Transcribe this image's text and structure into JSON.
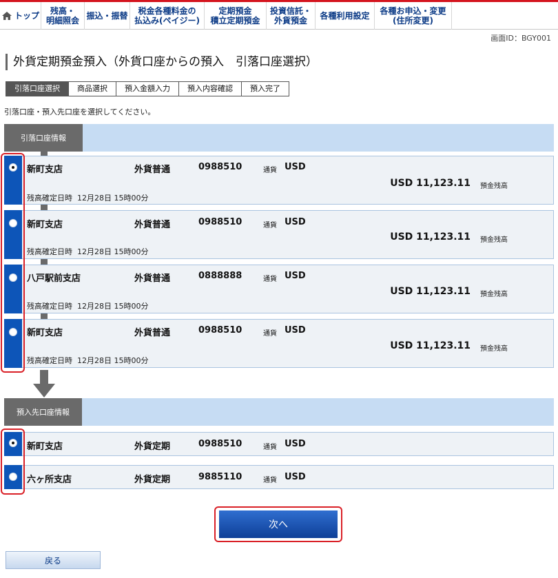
{
  "nav": {
    "items": [
      {
        "label": "トップ",
        "icon": "home-icon"
      },
      {
        "label": "残高・\n明細照会"
      },
      {
        "label": "振込・振替"
      },
      {
        "label": "税金各種料金の\n払込み(ペイジー)"
      },
      {
        "label": "定期預金\n積立定期預金"
      },
      {
        "label": "投資信託・\n外貨預金"
      },
      {
        "label": "各種利用設定"
      },
      {
        "label": "各種お申込・変更\n(住所変更)"
      }
    ]
  },
  "screen_id": "画面ID：BGY001",
  "page_title": "外貨定期預金預入（外貨口座からの預入　引落口座選択）",
  "steps": [
    "引落口座選択",
    "商品選択",
    "預入金額入力",
    "預入内容確認",
    "預入完了"
  ],
  "instruction": "引落口座・預入先口座を選択してください。",
  "debit_section": {
    "tab_label": "引落口座情報",
    "currency_label": "通貨",
    "confirm_label": "残高確定日時",
    "balance_label": "預金残高",
    "accounts": [
      {
        "branch": "新町支店",
        "type": "外貨普通",
        "number": "0988510",
        "currency": "USD",
        "confirm_time": "12月28日 15時00分",
        "balance": "USD 11,123.11",
        "selected": true
      },
      {
        "branch": "新町支店",
        "type": "外貨普通",
        "number": "0988510",
        "currency": "USD",
        "confirm_time": "12月28日 15時00分",
        "balance": "USD 11,123.11",
        "selected": false
      },
      {
        "branch": "八戸駅前支店",
        "type": "外貨普通",
        "number": "0888888",
        "currency": "USD",
        "confirm_time": "12月28日 15時00分",
        "balance": "USD 11,123.11",
        "selected": false
      },
      {
        "branch": "新町支店",
        "type": "外貨普通",
        "number": "0988510",
        "currency": "USD",
        "confirm_time": "12月28日 15時00分",
        "balance": "USD 11,123.11",
        "selected": false
      }
    ]
  },
  "deposit_section": {
    "tab_label": "預入先口座情報",
    "currency_label": "通貨",
    "accounts": [
      {
        "branch": "新町支店",
        "type": "外貨定期",
        "number": "0988510",
        "currency": "USD",
        "selected": true
      },
      {
        "branch": "六ヶ所支店",
        "type": "外貨定期",
        "number": "9885110",
        "currency": "USD",
        "selected": false
      }
    ]
  },
  "buttons": {
    "next": "次へ",
    "back": "戻る"
  },
  "colors": {
    "brand_red": "#d4141e",
    "nav_text": "#0b3a86",
    "radio_blue": "#0d55b8",
    "section_bar": "#c6dcf3"
  }
}
